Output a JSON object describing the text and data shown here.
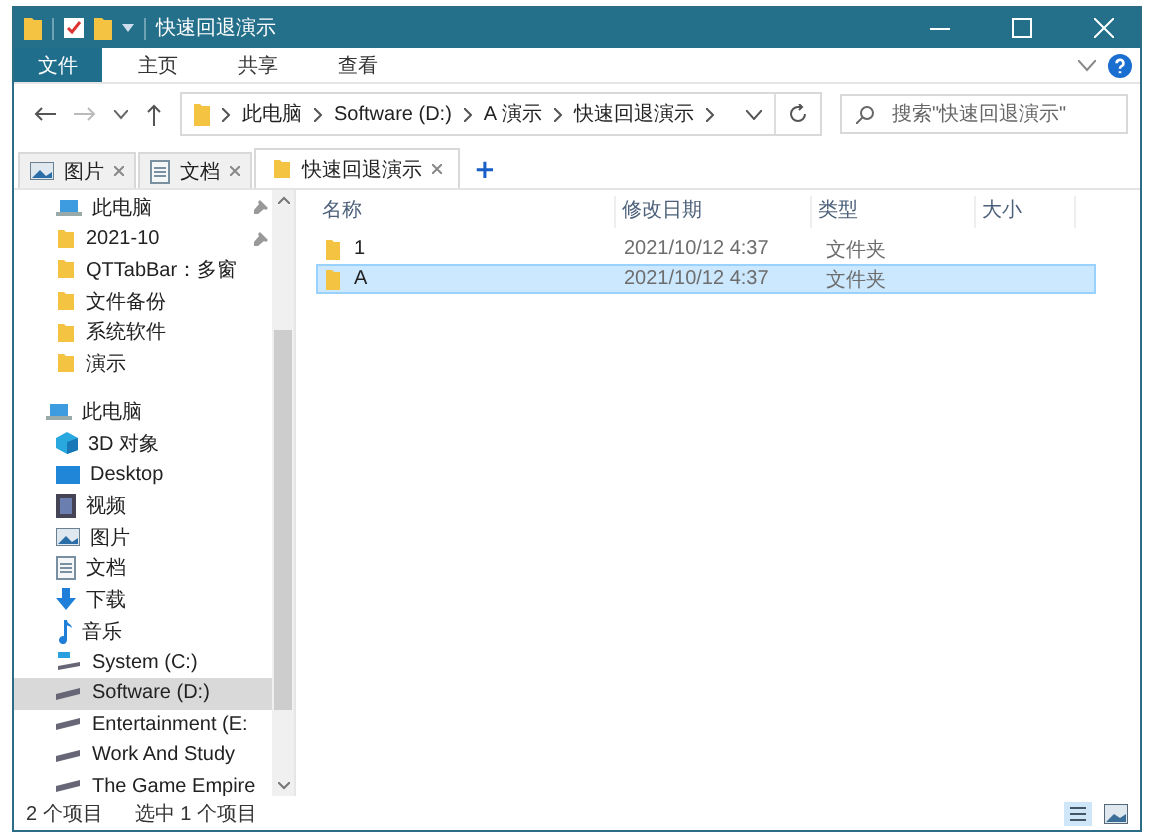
{
  "window": {
    "title": "快速回退演示"
  },
  "ribbon_tabs": [
    {
      "label": "文件",
      "selected": true
    },
    {
      "label": "主页",
      "selected": false
    },
    {
      "label": "共享",
      "selected": false
    },
    {
      "label": "查看",
      "selected": false
    }
  ],
  "breadcrumb": [
    "此电脑",
    "Software (D:)",
    "A 演示",
    "快速回退演示"
  ],
  "search": {
    "placeholder": "搜索\"快速回退演示\""
  },
  "folder_tabs": [
    {
      "label": "图片",
      "kind": "image",
      "selected": false
    },
    {
      "label": "文档",
      "kind": "doc",
      "selected": false
    },
    {
      "label": "快速回退演示",
      "kind": "folder",
      "selected": true
    }
  ],
  "add_tab": "+",
  "sidebar": {
    "items": [
      {
        "label": "此电脑",
        "kind": "pc",
        "pinned": true,
        "selected": false
      },
      {
        "label": "2021-10",
        "kind": "folder",
        "pinned": true,
        "selected": false
      },
      {
        "label": "QTTabBar：多窗",
        "kind": "folder",
        "selected": false
      },
      {
        "label": "文件备份",
        "kind": "folder",
        "selected": false
      },
      {
        "label": "系统软件",
        "kind": "folder",
        "selected": false
      },
      {
        "label": "演示",
        "kind": "folder",
        "selected": false
      },
      {
        "label": "此电脑",
        "kind": "pc",
        "selected": false,
        "children": [
          {
            "label": "3D 对象",
            "kind": "cube",
            "selected": false
          },
          {
            "label": "Desktop",
            "kind": "desktop",
            "selected": false
          },
          {
            "label": "视频",
            "kind": "video",
            "selected": false
          },
          {
            "label": "图片",
            "kind": "image",
            "selected": false
          },
          {
            "label": "文档",
            "kind": "doc",
            "selected": false
          },
          {
            "label": "下载",
            "kind": "download",
            "selected": false
          },
          {
            "label": "音乐",
            "kind": "music",
            "selected": false
          },
          {
            "label": "System (C:)",
            "kind": "drive-c",
            "selected": false
          },
          {
            "label": "Software (D:)",
            "kind": "drive",
            "selected": true
          },
          {
            "label": "Entertainment (E:",
            "kind": "drive",
            "selected": false
          },
          {
            "label": "Work And Study",
            "kind": "drive",
            "selected": false
          },
          {
            "label": "The Game Empire",
            "kind": "drive",
            "selected": false
          }
        ]
      }
    ]
  },
  "table": {
    "columns": [
      "名称",
      "修改日期",
      "类型",
      "大小"
    ],
    "rows": [
      {
        "name": "1",
        "modified": "2021/10/12 4:37",
        "type": "文件夹",
        "selected": false
      },
      {
        "name": "A",
        "modified": "2021/10/12 4:37",
        "type": "文件夹",
        "selected": true
      }
    ]
  },
  "status_bar": {
    "count": "2 个项目",
    "selection": "选中 1 个项目"
  }
}
